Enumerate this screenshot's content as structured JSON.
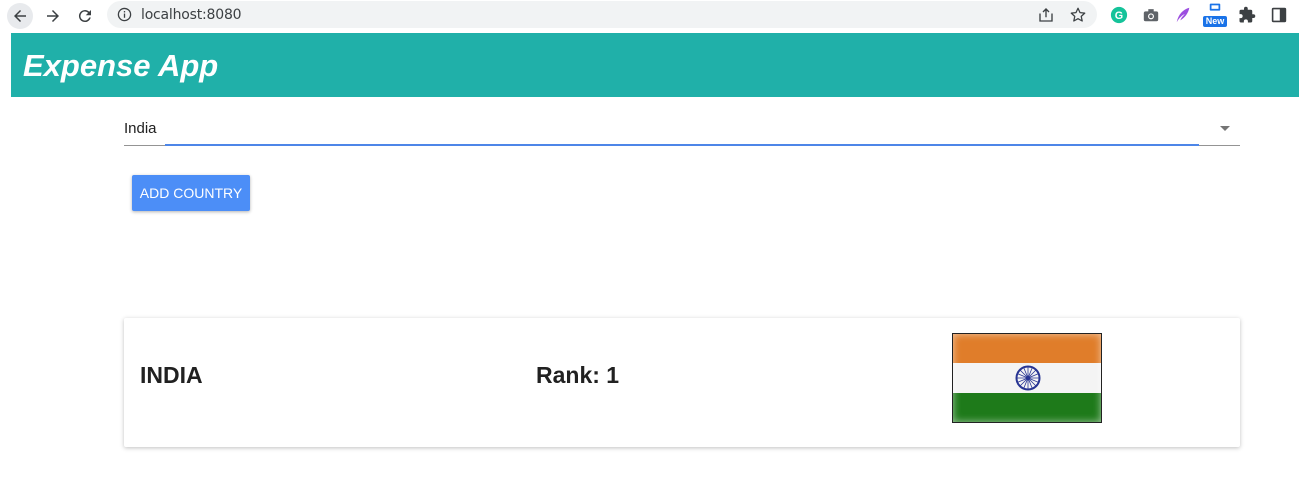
{
  "browser": {
    "url": "localhost:8080",
    "extension_badge": "New"
  },
  "app": {
    "title": "Expense App"
  },
  "country_select": {
    "value": "India"
  },
  "add_button": {
    "label": "ADD COUNTRY"
  },
  "card": {
    "country_name": "INDIA",
    "rank_label": "Rank:",
    "rank_value": "1",
    "flag_colors": [
      "#e07d2a",
      "#f4f4f4",
      "#1e7a1a"
    ],
    "chakra_color": "#283593"
  },
  "colors": {
    "appbar": "#20b0a9",
    "button": "#4c8ef7",
    "focus_underline": "#4d86e8"
  }
}
